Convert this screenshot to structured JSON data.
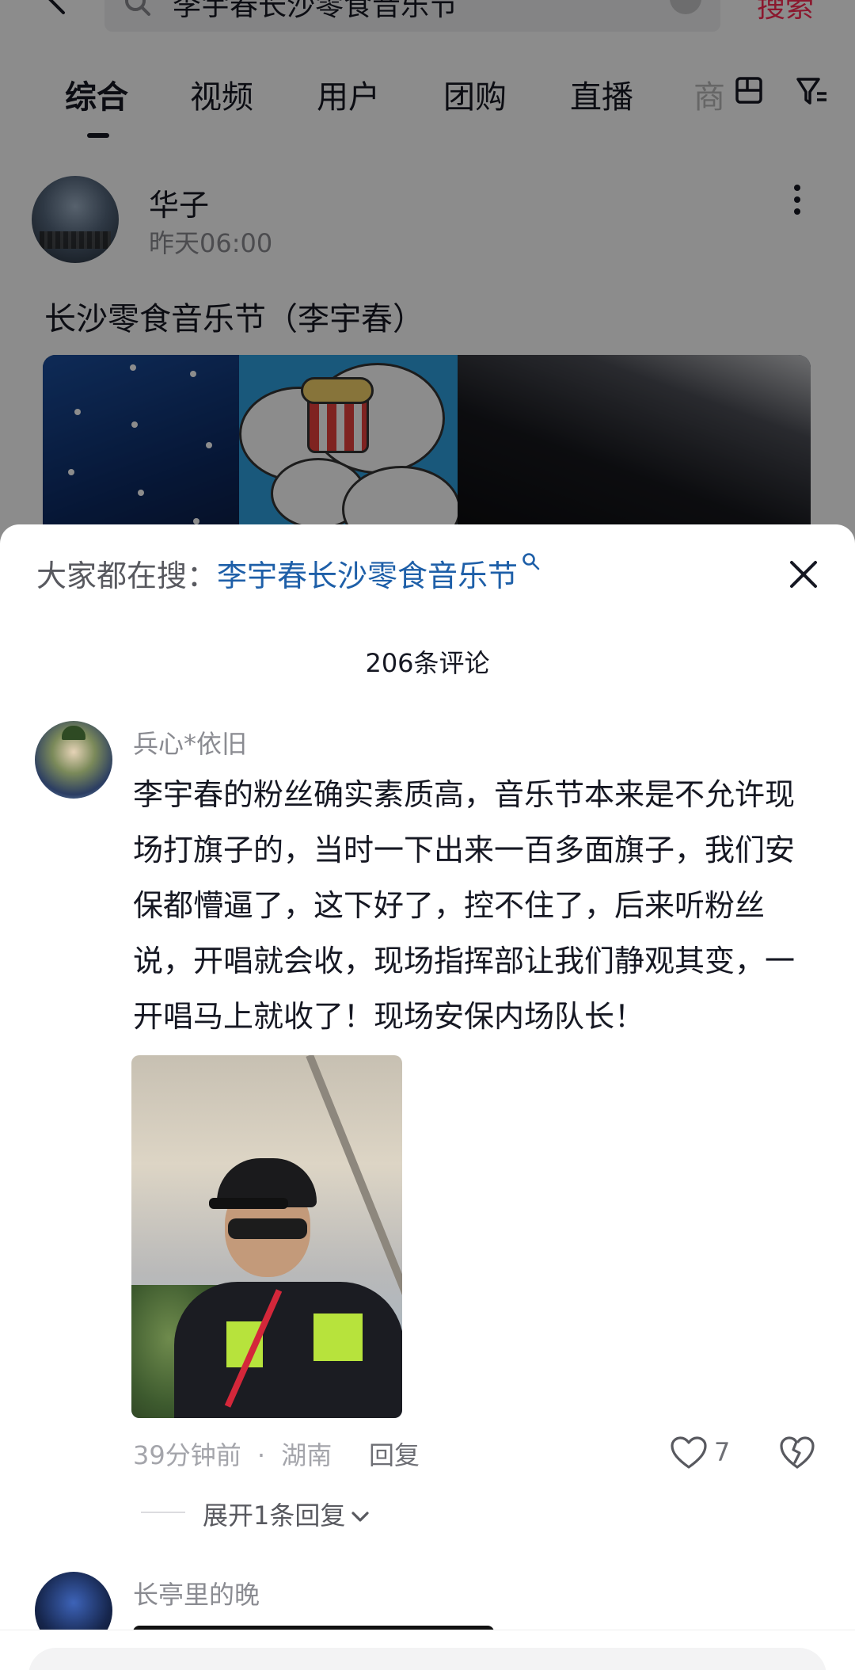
{
  "search": {
    "query": "李宇春长沙零食音乐节",
    "button_label": "搜索"
  },
  "tabs": [
    {
      "label": "综合",
      "active": true
    },
    {
      "label": "视频",
      "active": false
    },
    {
      "label": "用户",
      "active": false
    },
    {
      "label": "团购",
      "active": false
    },
    {
      "label": "直播",
      "active": false
    }
  ],
  "tab_overflow_label": "商",
  "post": {
    "author": "华子",
    "time": "昨天06:00",
    "title": "长沙零食音乐节（李宇春）"
  },
  "comments_sheet": {
    "trending_prefix": "大家都在搜：",
    "trending_query": "李宇春长沙零食音乐节",
    "count_label": "206条评论",
    "comments": [
      {
        "username": "兵心*依旧",
        "text": "李宇春的粉丝确实素质高，音乐节本来是不允许现场打旗子的，当时一下出来一百多面旗子，我们安保都懵逼了，这下好了，控不住了，后来听粉丝说，开唱就会收，现场指挥部让我们静观其变，一开唱马上就收了！现场安保内场队长！",
        "time": "39分钟前",
        "separator": "·",
        "location": "湖南",
        "reply_label": "回复",
        "like_count": "7",
        "expand_label": "展开1条回复"
      },
      {
        "username": "长亭里的晚"
      }
    ]
  },
  "colors": {
    "accent": "#fe2c55",
    "link": "#1e5fa8",
    "muted": "#8a8b91"
  }
}
